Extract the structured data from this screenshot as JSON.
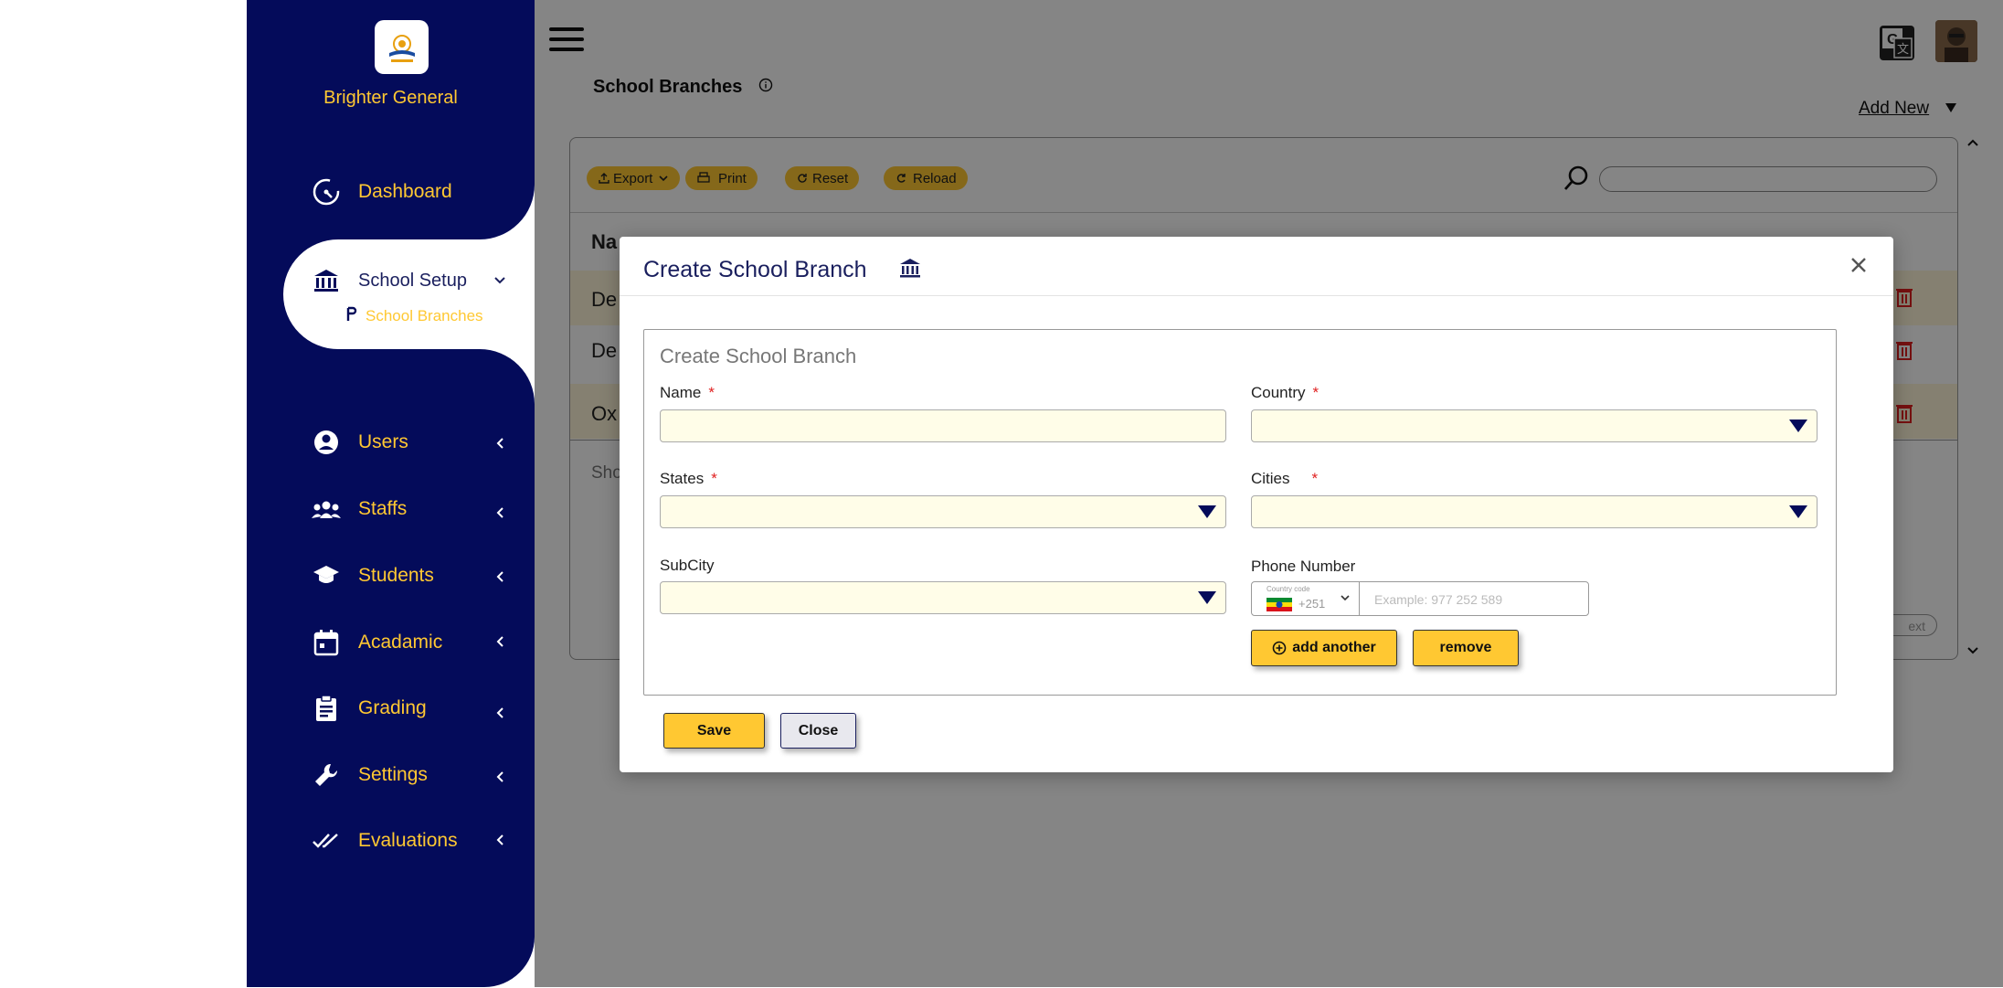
{
  "sidebar": {
    "brand": "Brighter General",
    "items": [
      {
        "label": "Dashboard",
        "icon": "speedometer-icon"
      },
      {
        "label": "School Setup",
        "icon": "bank-icon"
      },
      {
        "label": "School Branches",
        "icon": "branch-icon"
      },
      {
        "label": "Users",
        "icon": "user-circle-icon"
      },
      {
        "label": "Staffs",
        "icon": "group-icon"
      },
      {
        "label": "Students",
        "icon": "graduation-cap-icon"
      },
      {
        "label": "Acadamic",
        "icon": "calendar-icon"
      },
      {
        "label": "Grading",
        "icon": "clipboard-icon"
      },
      {
        "label": "Settings",
        "icon": "wrench-icon"
      },
      {
        "label": "Evaluations",
        "icon": "double-check-icon"
      }
    ]
  },
  "header": {
    "page_title": "School Branches",
    "add_new": "Add New"
  },
  "toolbar": {
    "export": "Export",
    "print": "Print",
    "reset": "Reset",
    "reload": "Reload"
  },
  "table": {
    "header_first": "Na",
    "rows": [
      "De",
      "De",
      "Ox"
    ],
    "footer": "Sho",
    "next": "ext"
  },
  "modal": {
    "title": "Create School Branch",
    "legend": "Create School Branch",
    "fields": {
      "name": {
        "label": "Name",
        "required": "*"
      },
      "country": {
        "label": "Country",
        "required": "*"
      },
      "states": {
        "label": "States",
        "required": "*"
      },
      "cities": {
        "label": "Cities",
        "required": "*"
      },
      "subcity": {
        "label": "SubCity"
      },
      "phone": {
        "label": "Phone Number",
        "country_code_label": "Country code",
        "country_code": "+251",
        "placeholder": "Example: 977 252 589"
      }
    },
    "buttons": {
      "add_another": "add another",
      "remove": "remove",
      "save": "Save",
      "close": "Close"
    }
  },
  "colors": {
    "sidebar_bg": "#040b5a",
    "accent": "#ffc832",
    "input_bg": "#fffde8",
    "required": "#e02020"
  }
}
